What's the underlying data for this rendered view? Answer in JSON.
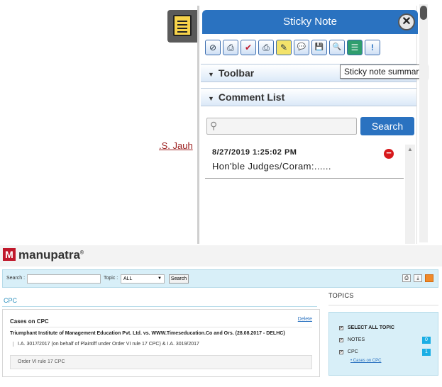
{
  "background": {
    "link_text": ".S. Jauh"
  },
  "sticky": {
    "title": "Sticky Note",
    "close_glyph": "✕",
    "toolbar_icons": [
      {
        "name": "disable-icon",
        "glyph": "⊘"
      },
      {
        "name": "print-icon",
        "glyph": "⎙"
      },
      {
        "name": "approve-icon",
        "glyph": "✔"
      },
      {
        "name": "print-all-icon",
        "glyph": "⎙"
      },
      {
        "name": "highlight-icon",
        "glyph": "✎"
      },
      {
        "name": "comment-icon",
        "glyph": "💬"
      },
      {
        "name": "save-icon",
        "glyph": "💾"
      },
      {
        "name": "zoom-icon",
        "glyph": "🔍"
      },
      {
        "name": "summary-icon",
        "glyph": "☰"
      },
      {
        "name": "info-icon",
        "glyph": "!"
      }
    ],
    "toolbar_section": "Toolbar",
    "comment_section": "Comment List",
    "tooltip": "Sticky note summary",
    "search_placeholder": "",
    "search_button": "Search",
    "comments": [
      {
        "date": "8/27/2019 1:25:02 PM",
        "text": "Hon'ble Judges/Coram:......"
      }
    ]
  },
  "manupatra": {
    "brand": "manupatra",
    "brand_mark": "M",
    "brand_reg": "®",
    "search_label": "Search :",
    "topic_label": "Topic :",
    "topic_selected": "ALL",
    "search_button": "Search",
    "breadcrumb": "CPC",
    "topics_title": "TOPICS",
    "card": {
      "title": "Cases on CPC",
      "delete": "Delete",
      "case_title": "Triumphant Institute of Management Education Pvt. Ltd. vs. WWW.Timeseducation.Co and Ors. (28.08.2017 - DELHC)",
      "case_detail": "I.A. 3017/2017 (on behalf of Plaintiff under Order VI rule 17 CPC) & I.A. 3019/2017",
      "tag": "Order VI rule 17 CPC"
    },
    "topics": [
      {
        "label": "SELECT ALL TOPIC",
        "badge": ""
      },
      {
        "label": "NOTES",
        "badge": "0"
      },
      {
        "label": "CPC",
        "badge": "1"
      }
    ],
    "topic_sub": "Cases on CPC",
    "colors": {
      "accent": "#2a72c0",
      "brand": "#c0182b",
      "badge": "#1aaee5"
    }
  }
}
